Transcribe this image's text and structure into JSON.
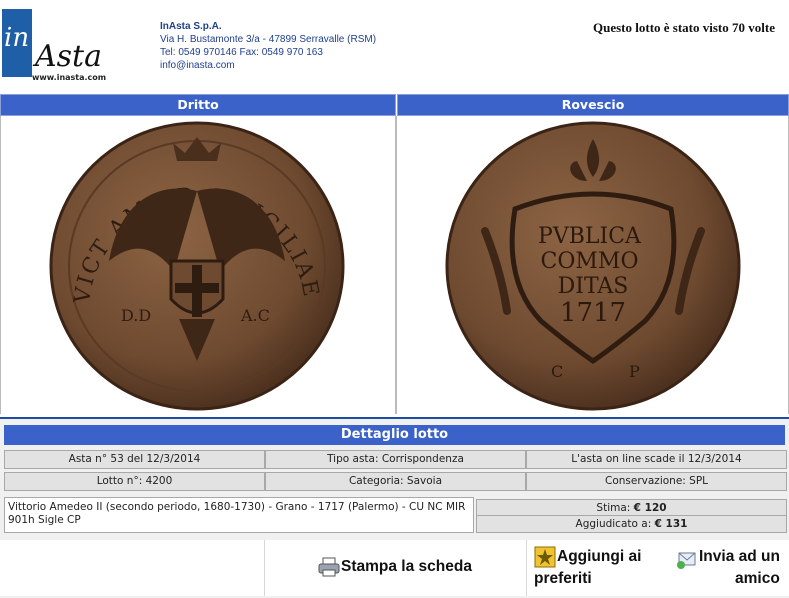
{
  "header": {
    "logo": {
      "part1": "in",
      "part2": "Asta",
      "url": "www.inasta.com"
    },
    "company": {
      "name": "InAsta S.p.A.",
      "address": "Via H. Bustamonte 3/a - 47899 Serravalle (RSM)",
      "phone": "Tel: 0549 970146 Fax: 0549 970 163",
      "email": "info@inasta.com"
    },
    "views_text": "Questo lotto è stato visto 70 volte"
  },
  "panels": {
    "obverse_title": "Dritto",
    "reverse_title": "Rovescio"
  },
  "coin": {
    "obverse_legend": "VICT AME D G SICILIAE ET HIER REX",
    "obverse_marks": [
      "D.D",
      "A.C"
    ],
    "reverse_lines": [
      "PVBLICA",
      "COMMO",
      "DITAS",
      "1717"
    ],
    "reverse_marks": [
      "C",
      "P"
    ],
    "colors": {
      "bronze": "#6e4a30",
      "bronze_dark": "#4a2f1d",
      "bronze_light": "#8d6444"
    }
  },
  "detail": {
    "title": "Dettaglio lotto",
    "row1": [
      "Asta n° 53 del 12/3/2014",
      "Tipo asta: Corrispondenza",
      "L'asta on line scade il 12/3/2014"
    ],
    "row2": [
      "Lotto n°: 4200",
      "Categoria: Savoia",
      "Conservazione: SPL"
    ],
    "description": "Vittorio Amedeo II (secondo periodo, 1680-1730) - Grano - 1717 (Palermo) - CU NC MIR 901h Sigle CP",
    "estimate_label": "Stima:",
    "estimate_value": "€ 120",
    "awarded_label": "Aggiudicato a:",
    "awarded_value": "€ 131"
  },
  "actions": {
    "print_label": "Stampa la scheda",
    "fav_line1": "Aggiungi ai",
    "fav_line2": "preferiti",
    "send_line1": "Invia ad un",
    "send_line2": "amico"
  },
  "theme": {
    "header_blue": "#3a62c9",
    "text_blue": "#1f3f8f"
  }
}
